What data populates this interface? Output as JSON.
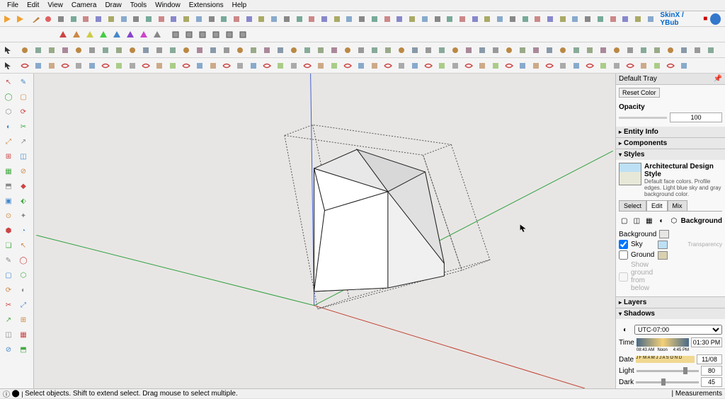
{
  "menu": [
    "File",
    "Edit",
    "View",
    "Camera",
    "Draw",
    "Tools",
    "Window",
    "Extensions",
    "Help"
  ],
  "brand": "SkinX / YBub",
  "tray": {
    "title": "Default Tray",
    "reset_color": "Reset Color",
    "opacity_label": "Opacity",
    "opacity_value": "100",
    "sections": {
      "entity": "Entity Info",
      "components": "Components",
      "styles": "Styles",
      "layers": "Layers",
      "shadows": "Shadows"
    },
    "style_name": "Architectural Design Style",
    "style_desc": "Default face colors. Profile edges. Light blue sky and gray background color.",
    "style_tabs": [
      "Select",
      "Edit",
      "Mix"
    ],
    "background_label": "Background",
    "bg_items": {
      "background": "Background",
      "sky": "Sky",
      "ground": "Ground",
      "transparency": "Transparency",
      "show_below": "Show ground from below"
    },
    "sky_checked": true,
    "ground_checked": false,
    "shadows": {
      "tz": "UTC-07:00",
      "time_label": "Time",
      "time_start": "08:43 AM",
      "time_noon": "Noon",
      "time_end": "4:45 PM",
      "time_value": "01:30 PM",
      "date_label": "Date",
      "months": "J F M A M J J A S O N D",
      "date_value": "11/08",
      "light_label": "Light",
      "light_value": "80",
      "dark_label": "Dark",
      "dark_value": "45"
    }
  },
  "status": {
    "hint": "Select objects. Shift to extend select. Drag mouse to select multiple.",
    "measurements": "Measurements"
  },
  "colors": {
    "bg": "#e8e6e4",
    "sky": "#bde0f5",
    "ground": "#e8e8d8"
  }
}
